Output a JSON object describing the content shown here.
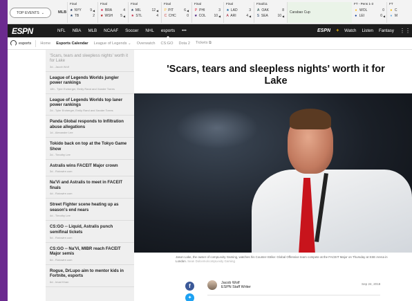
{
  "scores_bar": {
    "top_events_label": "TOP EVENTS",
    "league": "MLB",
    "games": [
      {
        "status": "Final",
        "teams": [
          {
            "abbr": "NYY",
            "score": "9"
          },
          {
            "abbr": "TB",
            "score": "2"
          }
        ]
      },
      {
        "status": "Final",
        "teams": [
          {
            "abbr": "BRA",
            "score": "4"
          },
          {
            "abbr": "WSH",
            "score": "5"
          }
        ]
      },
      {
        "status": "Final",
        "teams": [
          {
            "abbr": "MIL",
            "score": "12"
          },
          {
            "abbr": "STL",
            "score": "4"
          }
        ]
      },
      {
        "status": "Final",
        "teams": [
          {
            "abbr": "PIT",
            "score": "6"
          },
          {
            "abbr": "CHC",
            "score": "0"
          }
        ]
      },
      {
        "status": "Final",
        "teams": [
          {
            "abbr": "PHI",
            "score": "3"
          },
          {
            "abbr": "COL",
            "score": "10"
          }
        ]
      },
      {
        "status": "Final",
        "teams": [
          {
            "abbr": "LAD",
            "score": "3"
          },
          {
            "abbr": "ARI",
            "score": "4"
          }
        ]
      },
      {
        "status": "Final/11",
        "teams": [
          {
            "abbr": "OAK",
            "score": "8"
          },
          {
            "abbr": "SEA",
            "score": "10"
          }
        ]
      }
    ],
    "cup_label": "Carabao Cup",
    "cup_games": [
      {
        "status": "FT - Pens 1-3",
        "teams": [
          {
            "abbr": "WOL",
            "score": "0"
          },
          {
            "abbr": "LEI",
            "score": "0"
          }
        ]
      },
      {
        "status": "FT",
        "teams": [
          {
            "abbr": "C",
            "score": ""
          },
          {
            "abbr": "M",
            "score": ""
          }
        ]
      }
    ]
  },
  "navbar": {
    "logo": "ESPN",
    "items": [
      "NFL",
      "NBA",
      "MLB",
      "NCAAF",
      "Soccer",
      "NHL",
      "esports",
      "•••"
    ],
    "plus_prefix": "ESPN",
    "plus_suffix": "+",
    "watch": "Watch",
    "listen": "Listen",
    "fantasy": "Fantasy"
  },
  "subnav": {
    "section": "esports",
    "items": [
      "Home",
      "Esports Calendar",
      "League of Legends ⌄",
      "Overwatch",
      "CS:GO",
      "Dota 2",
      "Tickets ⧉"
    ]
  },
  "sidebar": {
    "items": [
      {
        "title": "'Scars, tears and sleepless nights' worth it for Lake",
        "meta": "3d - Jacob Wolf"
      },
      {
        "title": "League of Legends Worlds jungler power rankings",
        "meta": "18h - Tyler Erzberger, Emily Rand and Xander Torres"
      },
      {
        "title": "League of Legends Worlds top laner power rankings",
        "meta": "2d - Tyler Erzberger, Emily Rand and Xander Torres"
      },
      {
        "title": "Panda Global responds to Infiltration abuse allegations",
        "meta": "1d - Alexander Lee"
      },
      {
        "title": "Tokido back on top at the Tokyo Game Show",
        "meta": "2d - Timothy Lee"
      },
      {
        "title": "Astralis wins FACEIT Major crown",
        "meta": "3d - Rotowire.com"
      },
      {
        "title": "Na'Vi and Astralis to meet in FACEIT finals",
        "meta": "4d - Rotowire.com"
      },
      {
        "title": "Street Fighter scene heating up as season's end nears",
        "meta": "4d - Timothy Lee"
      },
      {
        "title": "CS:GO -- Liquid, Astralis punch semifinal tickets",
        "meta": "5d - Rotowire.com"
      },
      {
        "title": "CS:GO -- Na'Vi, MIBR reach FACEIT Major semis",
        "meta": "6d - Rotowire.com"
      },
      {
        "title": "Rogue, DrLupo aim to mentor kids in Fortnite, esports",
        "meta": "6d - Imad Khan"
      }
    ]
  },
  "article": {
    "headline": "'Scars, tears and sleepless nights' worth it for Lake",
    "caption": "Jason Lake, the owner of compLexity Gaming, watches his Counter-Strike: Global Offensive team compete at the FACEIT Major on Thursday at SSE Arena in London.",
    "credit": "Sean Dolcemo/compLexity Gaming",
    "author_name": "Jacob Wolf",
    "author_title": "ESPN Staff Writer",
    "date": "Sep 24, 2018"
  },
  "colors": {
    "background": "#6b2a8f",
    "navbar": "#1d1d1d",
    "accent_red": "#c8141c",
    "facebook": "#3b5998",
    "twitter": "#1da1f2"
  }
}
